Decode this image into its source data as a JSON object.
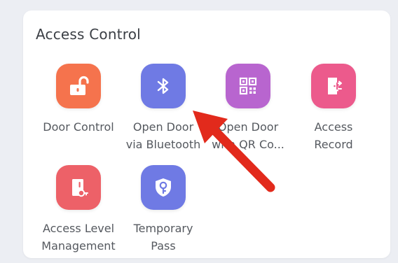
{
  "section": {
    "title": "Access Control"
  },
  "tiles": [
    {
      "label1": "Door Control",
      "label2": "",
      "icon": "unlock-icon",
      "color": "#f5734d"
    },
    {
      "label1": "Open Door",
      "label2": "via Bluetooth",
      "icon": "bluetooth-icon",
      "color": "#6f7ae4"
    },
    {
      "label1": "Open Door",
      "label2": "with QR Co...",
      "icon": "qr-code-icon",
      "color": "#b865cf"
    },
    {
      "label1": "Access",
      "label2": "Record",
      "icon": "access-record-icon",
      "color": "#ec5a8c"
    },
    {
      "label1": "Access Level",
      "label2": "Management",
      "icon": "access-level-icon",
      "color": "#ed6168"
    },
    {
      "label1": "Temporary",
      "label2": "Pass",
      "icon": "temporary-pass-icon",
      "color": "#6f7ae4"
    }
  ],
  "annotation": {
    "icon": "red-arrow-icon",
    "color": "#e22a1c"
  }
}
